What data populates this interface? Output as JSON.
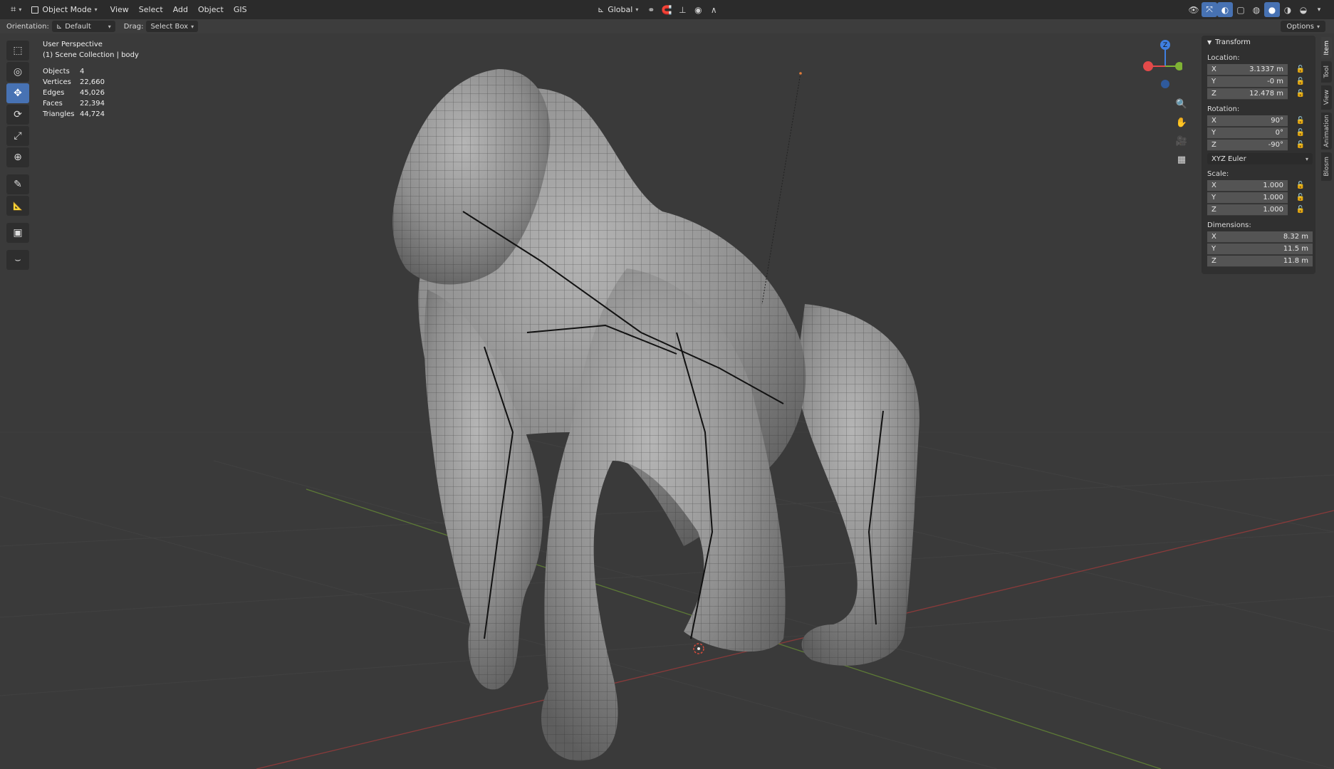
{
  "header": {
    "editor_type_icon": "3d-viewport-icon",
    "mode": "Object Mode",
    "menus": [
      "View",
      "Select",
      "Add",
      "Object",
      "GIS"
    ],
    "transform_orientation": "Global"
  },
  "tool_settings": {
    "orientation_label": "Orientation:",
    "orientation_value": "Default",
    "drag_label": "Drag:",
    "drag_value": "Select Box",
    "options_label": "Options"
  },
  "viewport": {
    "view_name": "User Perspective",
    "collection": "(1) Scene Collection | body",
    "stats": [
      {
        "label": "Objects",
        "value": "4"
      },
      {
        "label": "Vertices",
        "value": "22,660"
      },
      {
        "label": "Edges",
        "value": "45,026"
      },
      {
        "label": "Faces",
        "value": "22,394"
      },
      {
        "label": "Triangles",
        "value": "44,724"
      }
    ],
    "gizmo": {
      "z_label": "Z",
      "x_color": "#e34a4a",
      "y_color": "#7fb334",
      "z_color": "#3f7fe0"
    }
  },
  "tools": [
    {
      "name": "select-box-tool",
      "icon": "select-box-icon",
      "glyph": "⬚",
      "active": false
    },
    {
      "name": "cursor-tool",
      "icon": "cursor-icon",
      "glyph": "◎",
      "active": false
    },
    {
      "name": "move-tool",
      "icon": "move-icon",
      "glyph": "✥",
      "active": true
    },
    {
      "name": "rotate-tool",
      "icon": "rotate-icon",
      "glyph": "⟳",
      "active": false
    },
    {
      "name": "scale-tool",
      "icon": "scale-icon",
      "glyph": "⤢",
      "active": false
    },
    {
      "name": "transform-tool",
      "icon": "transform-icon",
      "glyph": "⊕",
      "active": false
    },
    {
      "name": "annotate-tool",
      "icon": "annotate-icon",
      "glyph": "✎",
      "active": false
    },
    {
      "name": "measure-tool",
      "icon": "measure-icon",
      "glyph": "📐",
      "active": false
    },
    {
      "name": "add-cube-tool",
      "icon": "add-cube-icon",
      "glyph": "▣",
      "active": false
    },
    {
      "name": "curve-tool",
      "icon": "curve-icon",
      "glyph": "⌣",
      "active": false
    }
  ],
  "npanel": {
    "title": "Transform",
    "location_label": "Location:",
    "location": [
      {
        "axis": "X",
        "value": "3.1337 m"
      },
      {
        "axis": "Y",
        "value": "-0 m"
      },
      {
        "axis": "Z",
        "value": "12.478 m"
      }
    ],
    "rotation_label": "Rotation:",
    "rotation": [
      {
        "axis": "X",
        "value": "90°"
      },
      {
        "axis": "Y",
        "value": "0°"
      },
      {
        "axis": "Z",
        "value": "-90°"
      }
    ],
    "rotation_mode": "XYZ Euler",
    "scale_label": "Scale:",
    "scale": [
      {
        "axis": "X",
        "value": "1.000"
      },
      {
        "axis": "Y",
        "value": "1.000"
      },
      {
        "axis": "Z",
        "value": "1.000"
      }
    ],
    "dimensions_label": "Dimensions:",
    "dimensions": [
      {
        "axis": "X",
        "value": "8.32 m"
      },
      {
        "axis": "Y",
        "value": "11.5 m"
      },
      {
        "axis": "Z",
        "value": "11.8 m"
      }
    ]
  },
  "side_tabs": [
    "Item",
    "Tool",
    "View",
    "Animation",
    "Blosm"
  ]
}
